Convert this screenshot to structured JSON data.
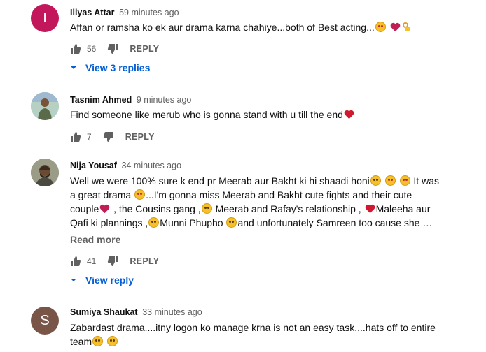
{
  "comments": [
    {
      "author": "Iliyas Attar",
      "time": "59 minutes ago",
      "avatar_letter": "I",
      "avatar_color": "#c2185b",
      "lines": [
        "Affan or ramsha ko ek aur drama karna chahiye...both of Best acting..."
      ],
      "likes": "56",
      "reply_label": "REPLY",
      "view_replies": "View 3 replies"
    },
    {
      "author": "Tasnim Ahmed",
      "time": "9 minutes ago",
      "lines": [
        "Find someone like merub who is gonna stand with u till the end"
      ],
      "likes": "7",
      "reply_label": "REPLY"
    },
    {
      "author": "Nija Yousaf",
      "time": "34 minutes ago",
      "lines": [
        "Well we were 100% sure k end pr Meerab aur Bakht ki hi shaadi honi",
        "It was",
        "a great drama",
        "...I'm gonna miss Meerab and Bakht cute fights and their cute",
        "couple",
        ", the Cousins gang ,",
        "Meerab and Rafay's relationship ,",
        "Maleeha aur",
        "Qafi ki plannings ,",
        "Munni Phupho",
        "and unfortunately Samreen too cause she …"
      ],
      "read_more": "Read more",
      "likes": "41",
      "reply_label": "REPLY",
      "view_replies": "View reply"
    },
    {
      "author": "Sumiya Shaukat",
      "time": "33 minutes ago",
      "avatar_letter": "S",
      "avatar_color": "#795548",
      "lines": [
        "Zabardast drama....itny logon ko manage krna is not an easy task....hats off to entire",
        "team"
      ]
    }
  ]
}
